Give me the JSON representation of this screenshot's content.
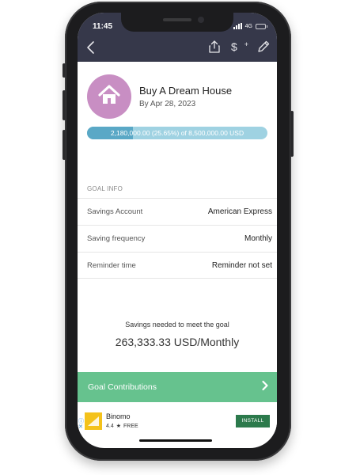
{
  "status": {
    "time": "11:45",
    "network": "4G"
  },
  "goal": {
    "title": "Buy A Dream House",
    "date": "By Apr 28, 2023",
    "progress_label": "2,180,000.00 (25.65%) of 8,500,000.00 USD",
    "progress_fraction": 0.2565
  },
  "info": {
    "section_label": "GOAL INFO",
    "rows": [
      {
        "key": "Savings Account",
        "value": "American Express"
      },
      {
        "key": "Saving frequency",
        "value": "Monthly"
      },
      {
        "key": "Reminder time",
        "value": "Reminder not set"
      }
    ]
  },
  "summary": {
    "caption": "Savings needed to meet the goal",
    "value": "263,333.33 USD/Monthly"
  },
  "contributions": {
    "label": "Goal Contributions"
  },
  "ad": {
    "name": "Binomo",
    "rating": "4.4",
    "price": "FREE",
    "install_label": "INSTALL"
  },
  "colors": {
    "header": "#36384a",
    "avatar": "#c88ec3",
    "progress_fill": "#5aa8c6",
    "progress_track": "#9fd2e2",
    "contributions_bar": "#66c28e",
    "install_button": "#2c7a4c"
  },
  "icons": {
    "back": "chevron-left-icon",
    "share": "share-icon",
    "add_money": "dollar-plus-icon",
    "edit": "pencil-icon",
    "goal": "house-icon",
    "contributions": "chevron-right-icon"
  }
}
